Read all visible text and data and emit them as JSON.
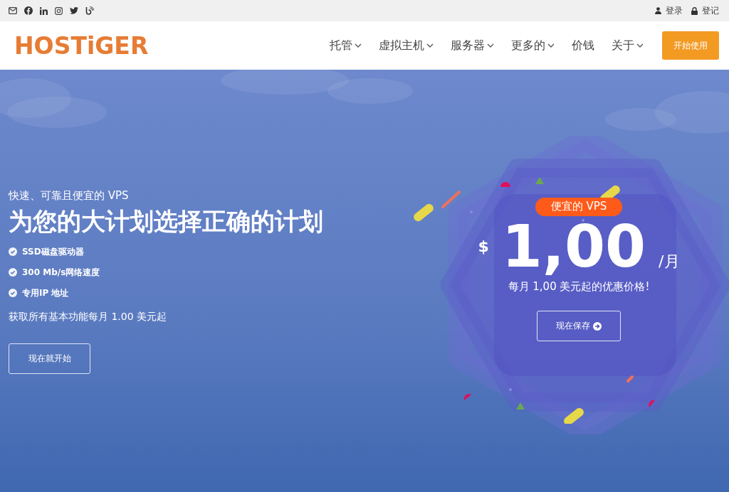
{
  "topbar": {
    "social": [
      {
        "kind": "mail"
      },
      {
        "kind": "facebook"
      },
      {
        "kind": "linkedin"
      },
      {
        "kind": "instagram"
      },
      {
        "kind": "twitter"
      },
      {
        "kind": "blog"
      }
    ],
    "links": [
      {
        "kind": "user",
        "label": "登录"
      },
      {
        "kind": "lock",
        "label": "登记"
      }
    ]
  },
  "header": {
    "logo": "HOSTiGER",
    "nav": [
      {
        "label": "托管",
        "dropdown": true
      },
      {
        "label": "虚拟主机",
        "dropdown": true
      },
      {
        "label": "服务器",
        "dropdown": true
      },
      {
        "label": "更多的",
        "dropdown": true
      },
      {
        "label": "价钱",
        "dropdown": false
      },
      {
        "label": "关于",
        "dropdown": true
      }
    ],
    "cta": "开始使用"
  },
  "hero": {
    "subtitle": "快速、可靠且便宜的 VPS",
    "title": "为您的大计划选择正确的计划",
    "features": [
      "SSD磁盘驱动器",
      "300 Mb/s网络速度",
      "专用IP 地址"
    ],
    "note": "获取所有基本功能每月 1.00 美元起",
    "button": "现在就开始"
  },
  "promo": {
    "badge": "便宜的 VPS",
    "currency": "$",
    "price": "1,00",
    "period": "/月",
    "caption": "每月 1,00 美元起的优惠价格!",
    "button": "现在保存"
  }
}
